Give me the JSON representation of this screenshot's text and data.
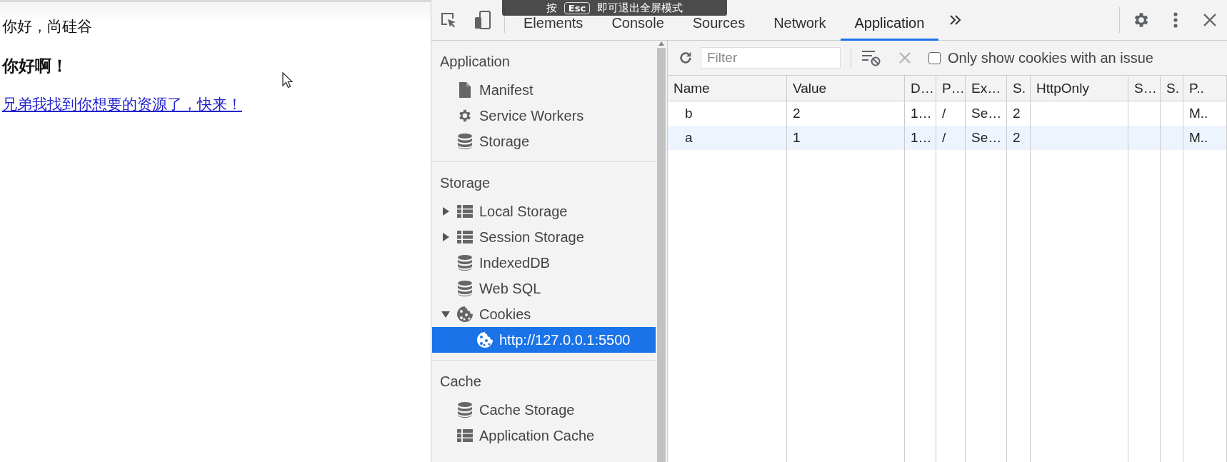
{
  "page": {
    "greeting": "你好，尚硅谷",
    "heading": "你好啊！",
    "link": "兄弟我找到你想要的资源了，快来！"
  },
  "fullscreen_notice": {
    "prefix": "按",
    "key": "Esc",
    "suffix": "即可退出全屏模式"
  },
  "devtools": {
    "tabs": [
      {
        "label": "Elements",
        "selected": false
      },
      {
        "label": "Console",
        "selected": false
      },
      {
        "label": "Sources",
        "selected": false
      },
      {
        "label": "Network",
        "selected": false
      },
      {
        "label": "Application",
        "selected": true
      }
    ],
    "sidebar": [
      {
        "title": "Application",
        "items": [
          {
            "label": "Manifest",
            "kind": "file",
            "selected": false
          },
          {
            "label": "Service Workers",
            "kind": "gear",
            "selected": false
          },
          {
            "label": "Storage",
            "kind": "database",
            "selected": false
          }
        ]
      },
      {
        "title": "Storage",
        "items": [
          {
            "label": "Local Storage",
            "kind": "table",
            "expanded": false,
            "selected": false
          },
          {
            "label": "Session Storage",
            "kind": "table",
            "expanded": false,
            "selected": false
          },
          {
            "label": "IndexedDB",
            "kind": "database",
            "selected": false
          },
          {
            "label": "Web SQL",
            "kind": "database",
            "selected": false
          },
          {
            "label": "Cookies",
            "kind": "cookie",
            "expanded": true,
            "selected": false,
            "children": [
              {
                "label": "http://127.0.0.1:5500",
                "kind": "cookie",
                "selected": true
              }
            ]
          }
        ]
      },
      {
        "title": "Cache",
        "items": [
          {
            "label": "Cache Storage",
            "kind": "database",
            "selected": false
          },
          {
            "label": "Application Cache",
            "kind": "table",
            "selected": false
          }
        ]
      }
    ],
    "filter": {
      "placeholder": "Filter"
    },
    "issue_checkbox": {
      "label": "Only show cookies with an issue",
      "checked": false
    },
    "table": {
      "columns": [
        "Name",
        "Value",
        "D…",
        "P…",
        "Ex…",
        "S.",
        "HttpOnly",
        "S…",
        "S.",
        "P.."
      ],
      "rows": [
        {
          "column_1": "b",
          "column_2": "2",
          "column_3": "1…",
          "column_4": "/",
          "column_5": "Se…",
          "column_6": "2",
          "column_10": "M.."
        },
        {
          "column_1": "a",
          "column_2": "1",
          "column_3": "1…",
          "column_4": "/",
          "column_5": "Se…",
          "column_6": "2",
          "column_10": "M.."
        }
      ]
    }
  }
}
